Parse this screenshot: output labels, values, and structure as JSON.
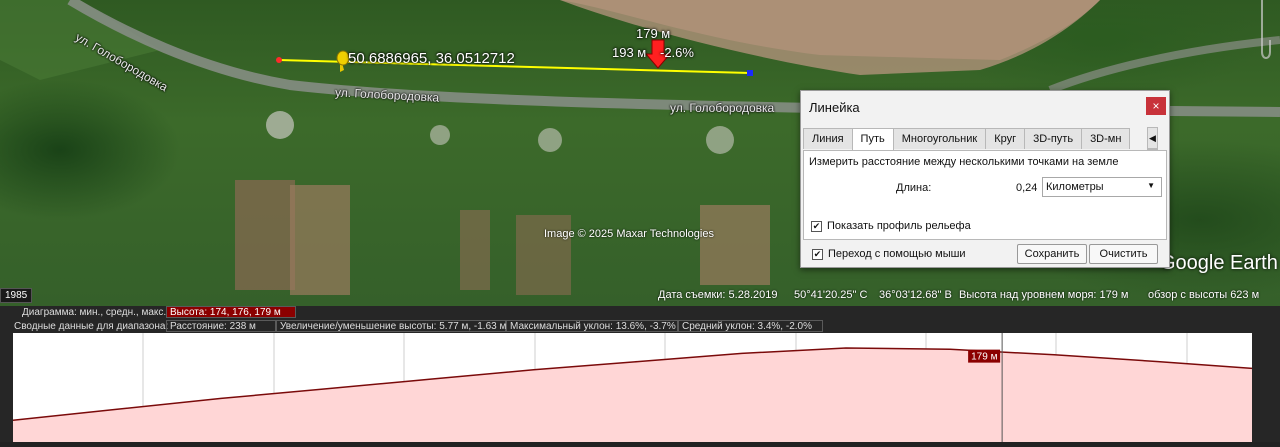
{
  "map": {
    "road_labels": [
      "ул. Голобородовка",
      "ул. Голобородовка",
      "ул. Голобородовка"
    ],
    "ruler": {
      "elevation_label": "179 м",
      "segment_label": "193 м",
      "slope_label": "-2.6%",
      "coordinates": "50.6886965, 36.0512712"
    },
    "image_credit": "Image © 2025 Maxar Technologies",
    "logo": "Google Earth",
    "year_badge": "1985"
  },
  "status_bar": {
    "date": "Дата съемки: 5.28.2019",
    "lat": "50°41'20.25\" С",
    "lon": "36°03'12.68\" В",
    "elevation": "Высота над уровнем моря:  179 м",
    "eye_alt": "обзор с высоты     623 м"
  },
  "dialog": {
    "title": "Линейка",
    "close": "×",
    "tabs": [
      "Линия",
      "Путь",
      "Многоугольник",
      "Круг",
      "3D-путь",
      "3D-мн"
    ],
    "active_tab": "Путь",
    "tab_prev": "◀",
    "tab_next": "▶",
    "description": "Измерить расстояние между несколькими точками на земле",
    "length_label": "Длина:",
    "length_value": "0,24",
    "unit": "Километры",
    "show_profile_label": "Показать профиль рельефа",
    "show_profile_checked": true,
    "mouse_nav_label": "Переход с помощью мыши",
    "mouse_nav_checked": true,
    "save_button": "Сохранить",
    "clear_button": "Очистить"
  },
  "elevation_panel": {
    "row1": {
      "label": "Диаграмма: мин., средн., макс.",
      "value": "Высота: 174, 176, 179 м"
    },
    "row2": {
      "label": "Сводные данные для диапазона:",
      "distance": "Расстояние: 238 м",
      "gain_loss": "Увеличение/уменьшение высоты: 5.77 м, -1.63 м",
      "max_slope": "Максимальный уклон: 13.6%, -3.7%",
      "avg_slope": "Средний уклон: 3.4%, -2.0%"
    },
    "marker_label": "179 м",
    "colors": {
      "profile_line": "#7a0a0a",
      "profile_fill": "#ffd6d6",
      "highlight": "#8b0000"
    }
  },
  "chart_data": {
    "type": "area",
    "x": [
      0,
      20,
      40,
      60,
      80,
      100,
      120,
      140,
      160,
      180,
      200,
      220,
      238
    ],
    "values": [
      173.6,
      174.4,
      175.2,
      175.9,
      176.6,
      177.3,
      177.9,
      178.5,
      178.9,
      178.8,
      178.4,
      177.9,
      177.4
    ],
    "ylim": [
      172,
      180
    ],
    "marker_x": 190,
    "marker_value": 179
  }
}
